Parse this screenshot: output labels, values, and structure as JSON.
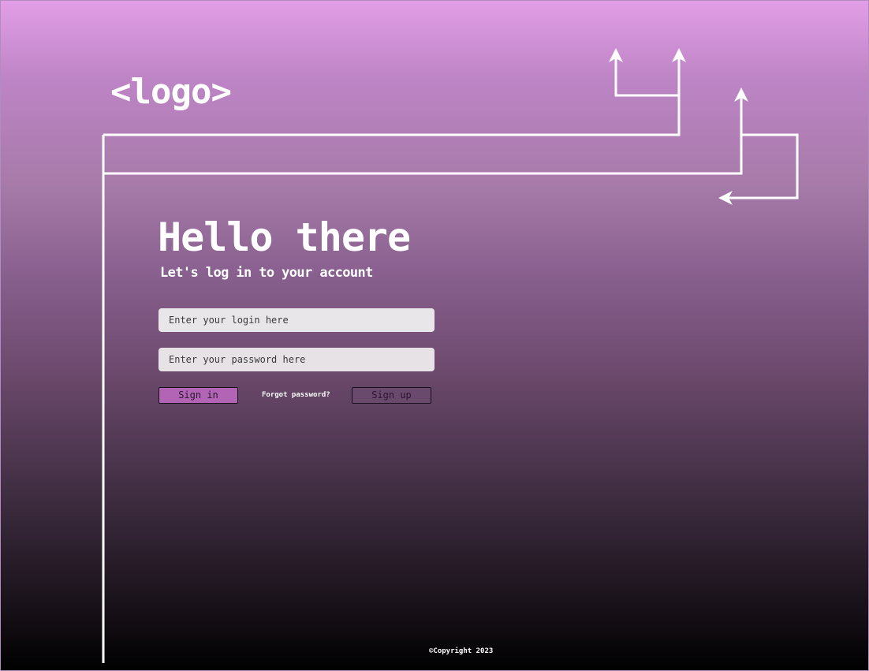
{
  "header": {
    "logo_text": "<logo>"
  },
  "main": {
    "title": "Hello there",
    "subtitle": "Let's log in to your account"
  },
  "form": {
    "login": {
      "value": "",
      "placeholder": "Enter your login here"
    },
    "password": {
      "value": "",
      "placeholder": "Enter your password here"
    },
    "sign_in_label": "Sign in",
    "forgot_label": "Forgot password?",
    "sign_up_label": "Sign up"
  },
  "footer": {
    "copyright": "©Copyright 2023"
  },
  "icons": {
    "decoration": "circuit-line-arrows"
  },
  "colors": {
    "gradient_top": "#e29ee6",
    "gradient_bottom": "#000000",
    "sign_in_button": "#b265b4",
    "sign_up_button": "#6a4a6c",
    "input_background": "#e8e6e8",
    "line_color": "#ffffff"
  }
}
